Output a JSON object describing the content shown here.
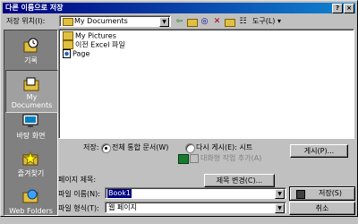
{
  "window": {
    "title": "다른 이름으로 저장",
    "help_btn": "?",
    "close_btn": "×"
  },
  "toolbar": {
    "location_label": "저장 위치(I):",
    "location_value": "My Documents",
    "tools_label": "도구(L) ▾"
  },
  "places": [
    {
      "label": "기록",
      "icon": "history-icon"
    },
    {
      "label": "My Documents",
      "icon": "my-documents-icon"
    },
    {
      "label": "바탕 화면",
      "icon": "desktop-icon"
    },
    {
      "label": "즐겨찾기",
      "icon": "favorites-icon"
    },
    {
      "label": "Web Folders",
      "icon": "web-folders-icon"
    }
  ],
  "files": [
    {
      "name": "My Pictures",
      "icon": "folder-icon"
    },
    {
      "name": "이전 Excel 파일",
      "icon": "folder-icon"
    },
    {
      "name": "Page",
      "icon": "web-page-icon"
    }
  ],
  "save_options": {
    "label": "저장:",
    "option_workbook": "전체 통합 문서(W)",
    "option_selection": "다시 게시(E): 시트",
    "interactive_label": "대화형 작업 추가(A)",
    "publish_button": "게시(P)..."
  },
  "page_title": {
    "label": "페이지 제목:",
    "change_button": "제목 변경(C)..."
  },
  "file_name": {
    "label": "파일 이름(N):",
    "value": "Book1"
  },
  "file_type": {
    "label": "파일 형식(T):",
    "value": "웹 페이지"
  },
  "buttons": {
    "save": "저장(S)",
    "cancel": "취소"
  }
}
